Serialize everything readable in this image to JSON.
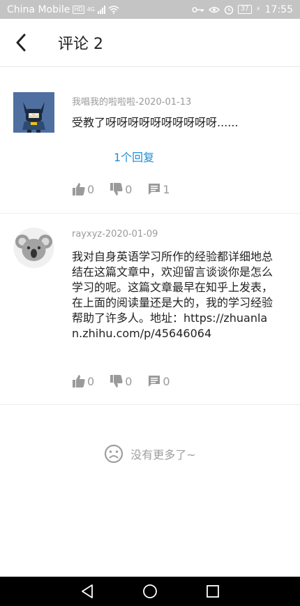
{
  "status_bar": {
    "carrier": "China Mobile",
    "hd": "HD",
    "network": "4G",
    "battery": "37",
    "time": "17:55"
  },
  "header": {
    "title": "评论 2"
  },
  "comments": [
    {
      "meta": "我唱我的啦啦啦-2020-01-13",
      "content": "受教了呀呀呀呀呀呀呀呀呀呀......",
      "reply_link": "1个回复",
      "likes": "0",
      "dislikes": "0",
      "replies": "1",
      "avatar_icon": "batman-avatar-icon"
    },
    {
      "meta": "rayxyz-2020-01-09",
      "content": "我对自身英语学习所作的经验都详细地总结在这篇文章中，欢迎留言谈谈你是怎么学习的呢。这篇文章最早在知乎上发表，在上面的阅读量还是大的，我的学习经验帮助了许多人。地址：https://zhuanlan.zhihu.com/p/45646064",
      "likes": "0",
      "dislikes": "0",
      "replies": "0",
      "avatar_icon": "koala-avatar-icon"
    }
  ],
  "footer": {
    "no_more": "没有更多了~"
  },
  "colors": {
    "status_bar": "#c4c4c4",
    "link": "#1e8ed6",
    "muted": "#9a9a9a",
    "nav_bar": "#000000"
  }
}
